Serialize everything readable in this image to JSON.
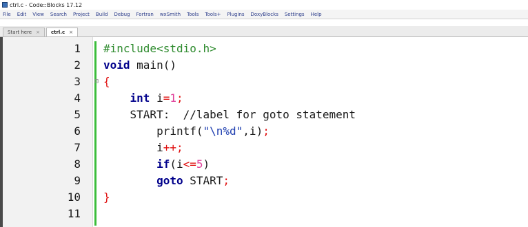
{
  "window": {
    "title": "ctrl.c - Code::Blocks 17.12"
  },
  "menu": [
    "File",
    "Edit",
    "View",
    "Search",
    "Project",
    "Build",
    "Debug",
    "Fortran",
    "wxSmith",
    "Tools",
    "Tools+",
    "Plugins",
    "DoxyBlocks",
    "Settings",
    "Help"
  ],
  "tabs": [
    {
      "label": "Start here"
    },
    {
      "label": "ctrl.c"
    }
  ],
  "editor": {
    "lines": [
      {
        "n": "1",
        "text": "#include<stdio.h>"
      },
      {
        "n": "2",
        "text": "void main()"
      },
      {
        "n": "3",
        "text": "{"
      },
      {
        "n": "4",
        "text": "    int i=1;"
      },
      {
        "n": "5",
        "text": "    START:  //label for goto statement"
      },
      {
        "n": "6",
        "text": "        printf(\"\\n%d\",i);"
      },
      {
        "n": "7",
        "text": "        i++;"
      },
      {
        "n": "8",
        "text": "        if(i<=5)"
      },
      {
        "n": "9",
        "text": "        goto START;"
      },
      {
        "n": "10",
        "text": "}"
      },
      {
        "n": "11",
        "text": ""
      }
    ]
  },
  "colors": {
    "keyword": "#00008b",
    "preprocessor": "#2e8b2e",
    "operator": "#e01010",
    "string": "#1f3fb0",
    "number": "#e0409a",
    "change_bar": "#3bbd3b"
  }
}
